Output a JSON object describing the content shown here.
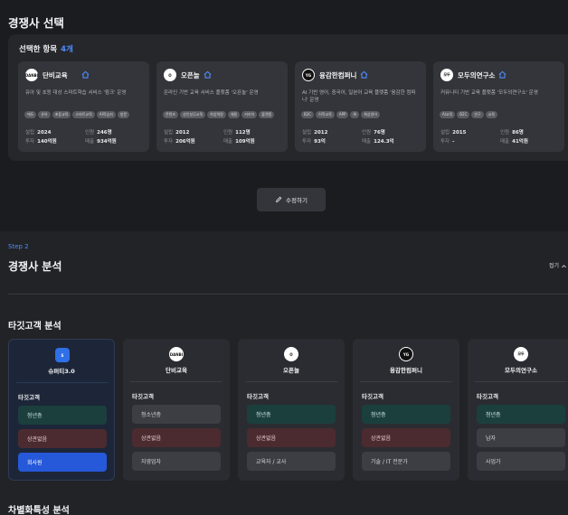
{
  "selection": {
    "title": "경쟁사 선택",
    "selected_label": "선택한 항목",
    "selected_count": "4개",
    "edit_button": "수정하기",
    "cards": [
      {
        "name": "단비교육",
        "logo_text": "DANBI",
        "description": "유아 및 초등 대상 스마트학습 서비스 '윙크' 운영",
        "tags": [
          "에듀",
          "유아",
          "초등교육",
          "스마트교육",
          "AI학습지",
          "방문"
        ],
        "founded_label": "설립",
        "founded": "2024",
        "staff_label": "인원",
        "staff": "246명",
        "invest_label": "투자",
        "invest": "140억원",
        "revenue_label": "매출",
        "revenue": "934억원"
      },
      {
        "name": "오픈놀",
        "logo_text": "O",
        "description": "온라인 기반 교육 서비스 플랫폼 '오픈놀' 운영",
        "tags": [
          "콘텐츠",
          "성인실무교육",
          "취업역량",
          "채용",
          "커리어",
          "플랫폼"
        ],
        "founded_label": "설립",
        "founded": "2012",
        "staff_label": "인원",
        "staff": "112명",
        "invest_label": "투자",
        "invest": "206억원",
        "revenue_label": "매출",
        "revenue": "109억원"
      },
      {
        "name": "융감한컴퍼니",
        "logo_text": "YG",
        "description": "AI 기반 영어, 중국어, 일본어 교육 플랫폼 '융감한 컴퍼니' 운영",
        "tags": [
          "B2C",
          "어학교육",
          "APP",
          "AI",
          "화상영어"
        ],
        "founded_label": "설립",
        "founded": "2012",
        "staff_label": "인원",
        "staff": "76명",
        "invest_label": "투자",
        "invest": "93억",
        "revenue_label": "매출",
        "revenue": "124.3억"
      },
      {
        "name": "모두의연구소",
        "logo_text": "모두",
        "description": "커뮤니티 기반 교육 플랫폼 '모두의연구소' 운영",
        "tags": [
          "AI교육",
          "B2C",
          "연구",
          "교육"
        ],
        "founded_label": "설립",
        "founded": "2015",
        "staff_label": "인원",
        "staff": "86명",
        "invest_label": "투자",
        "invest": "-",
        "revenue_label": "매출",
        "revenue": "41억원"
      }
    ]
  },
  "analysis": {
    "step": "Step 2",
    "title": "경쟁사 분석",
    "fold": "접기",
    "target_title": "타깃고객 분석",
    "target_label": "타깃고객",
    "next_title": "차별화특성 분석",
    "companies": [
      {
        "name": "슈퍼티3.0",
        "logo_text": "S",
        "chips": [
          "청년층",
          "상관없음",
          "회사원"
        ]
      },
      {
        "name": "단비교육",
        "logo_text": "DANBI",
        "chips": [
          "청소년층",
          "상관없음",
          "자영업자"
        ]
      },
      {
        "name": "오픈놀",
        "logo_text": "O",
        "chips": [
          "청년층",
          "상관없음",
          "교육자 / 교사"
        ]
      },
      {
        "name": "융감한컴퍼니",
        "logo_text": "YG",
        "chips": [
          "청년층",
          "상관없음",
          "기술 / IT 전문가"
        ]
      },
      {
        "name": "모두의연구소",
        "logo_text": "모두",
        "chips": [
          "청년층",
          "남자",
          "사업가"
        ]
      }
    ]
  },
  "colors": {
    "accent": "#4c8dff",
    "teal": "#1b3f3d",
    "maroon": "#4b2b2f",
    "blue": "#2659d9"
  },
  "icons": [
    "home-icon",
    "pencil-icon",
    "chevron-up-icon"
  ]
}
